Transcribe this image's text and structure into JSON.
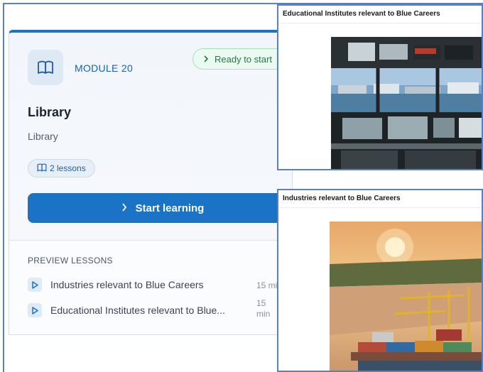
{
  "module": {
    "label": "MODULE 20",
    "status": "Ready to start",
    "title": "Library",
    "subtitle": "Library",
    "lessons_count": "2 lessons",
    "start_label": "Start learning",
    "preview_heading": "PREVIEW LESSONS",
    "lessons": [
      {
        "title": "Industries relevant to Blue Careers",
        "duration": "15 mi"
      },
      {
        "title": "Educational Institutes relevant to Blue...",
        "duration": "15\nmin"
      }
    ]
  },
  "panels": [
    {
      "title": "Educational Institutes relevant to Blue Careers",
      "image": "ship-bridge-control-room"
    },
    {
      "title": "Industries relevant to Blue Careers",
      "image": "container-port-sunset"
    }
  ],
  "colors": {
    "accent": "#1a73c5",
    "badge_green": "#1f7a45",
    "panel_border": "#5b7fc4"
  }
}
